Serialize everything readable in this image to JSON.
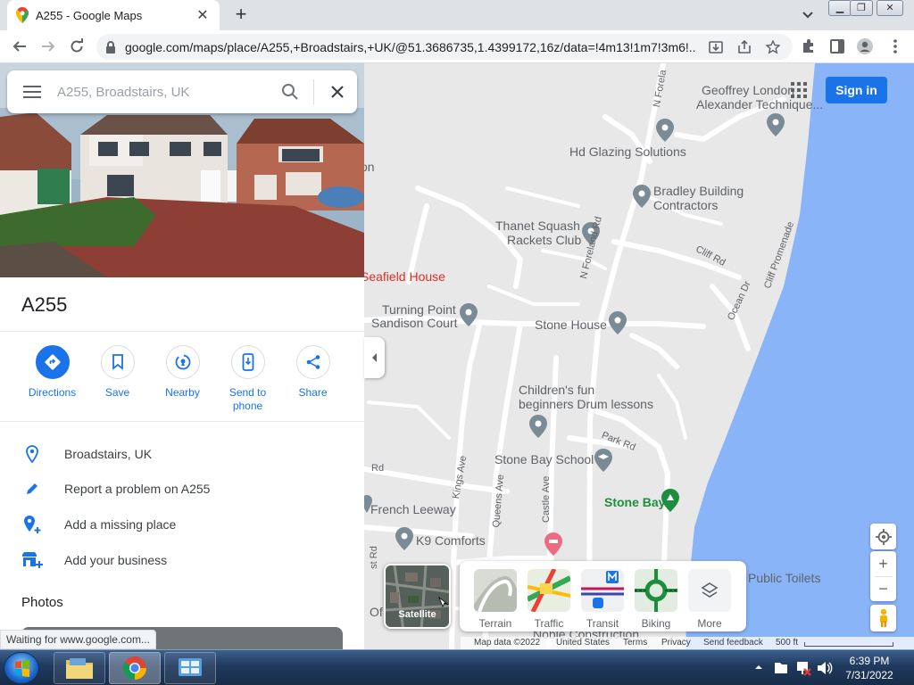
{
  "browser": {
    "tab_title": "A255 - Google Maps",
    "url": "google.com/maps/place/A255,+Broadstairs,+UK/@51.3686735,1.4399172,16z/data=!4m13!1m7!3m6!..."
  },
  "search": {
    "value": "",
    "placeholder": "A255, Broadstairs, UK"
  },
  "place": {
    "title": "A255",
    "actions": [
      {
        "label": "Directions",
        "icon": "directions-icon"
      },
      {
        "label": "Save",
        "icon": "bookmark-icon"
      },
      {
        "label": "Nearby",
        "icon": "nearby-icon"
      },
      {
        "label": "Send to phone",
        "icon": "phone-icon"
      },
      {
        "label": "Share",
        "icon": "share-icon"
      }
    ],
    "info": [
      {
        "text": "Broadstairs, UK",
        "icon": "location-pin-icon"
      },
      {
        "text": "Report a problem on A255",
        "icon": "pencil-icon"
      },
      {
        "text": "Add a missing place",
        "icon": "add-place-icon"
      },
      {
        "text": "Add your business",
        "icon": "add-business-icon"
      }
    ],
    "photos_title": "Photos"
  },
  "status": "Waiting for www.google.com...",
  "map": {
    "signin": "Sign in",
    "places": {
      "geoffrey": "Geoffrey London",
      "alexander": "Alexander Technique...",
      "hd_glazing": "Hd Glazing Solutions",
      "bradley_1": "Bradley Building",
      "bradley_2": "Contractors",
      "thanet_1": "Thanet Squash",
      "thanet_2": "Rackets Club",
      "seafield": "Seafield House",
      "turning_1": "Turning Point",
      "turning_2": "Sandison Court",
      "stone_house": "Stone House",
      "childrens_1": "Children's fun",
      "childrens_2": "beginners Drum lessons",
      "stone_bay_school": "Stone Bay School",
      "stone_bay": "Stone Bay",
      "french_leeway": "French Leeway",
      "k9": "K9 Comforts",
      "toilets": "Public Toilets",
      "noble": "Noble Construction",
      "on_fragment": "on",
      "of_fragment": "Of",
      "rd_fragment": "Rd",
      "st_rd_fragment": "st Rd"
    },
    "roads": {
      "n_foreland_rd": "N Foreland Rd",
      "n_foreland_top": "N Forela",
      "cliff_rd": "Cliff Rd",
      "cliff_promenade": "Cliff Promenade",
      "ocean_dr": "Ocean Dr",
      "park_rd": "Park Rd",
      "kings_ave": "Kings Ave",
      "queens_ave": "Queens Ave",
      "castle_ave": "Castle Ave"
    },
    "layers": {
      "satellite": "Satellite",
      "terrain": "Terrain",
      "traffic": "Traffic",
      "transit": "Transit",
      "biking": "Biking",
      "more": "More"
    },
    "attribution": {
      "data": "Map data ©2022",
      "country": "United States",
      "terms": "Terms",
      "privacy": "Privacy",
      "feedback": "Send feedback",
      "scale": "500 ft"
    },
    "colors": {
      "water": "#8ab4f8",
      "land": "#e8e8e8",
      "road": "#ffffff",
      "pin": "#7b8b96",
      "park": "#1e8e3e",
      "accent": "#1a73e8",
      "poi_red": "#d93025"
    }
  },
  "taskbar": {
    "time": "6:39 PM",
    "date": "7/31/2022"
  }
}
